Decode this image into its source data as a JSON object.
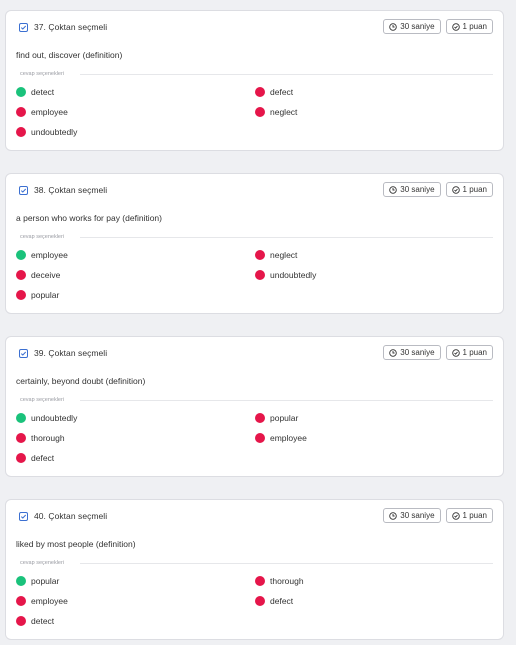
{
  "colors": {
    "correct": "#1ac27b",
    "wrong": "#e5164a"
  },
  "questions": [
    {
      "title": "37. Çoktan seçmeli",
      "time": "30 saniye",
      "points": "1 puan",
      "text": "find out, discover (definition)",
      "options_label": "cevap seçenekleri",
      "options": [
        {
          "label": "detect",
          "correct": true
        },
        {
          "label": "defect",
          "correct": false
        },
        {
          "label": "employee",
          "correct": false
        },
        {
          "label": "neglect",
          "correct": false
        },
        {
          "label": "undoubtedly",
          "correct": false
        }
      ]
    },
    {
      "title": "38. Çoktan seçmeli",
      "time": "30 saniye",
      "points": "1 puan",
      "text": "a person who works for pay (definition)",
      "options_label": "cevap seçenekleri",
      "options": [
        {
          "label": "employee",
          "correct": true
        },
        {
          "label": "neglect",
          "correct": false
        },
        {
          "label": "deceive",
          "correct": false
        },
        {
          "label": "undoubtedly",
          "correct": false
        },
        {
          "label": "popular",
          "correct": false
        }
      ]
    },
    {
      "title": "39. Çoktan seçmeli",
      "time": "30 saniye",
      "points": "1 puan",
      "text": "certainly, beyond doubt (definition)",
      "options_label": "cevap seçenekleri",
      "options": [
        {
          "label": "undoubtedly",
          "correct": true
        },
        {
          "label": "popular",
          "correct": false
        },
        {
          "label": "thorough",
          "correct": false
        },
        {
          "label": "employee",
          "correct": false
        },
        {
          "label": "defect",
          "correct": false
        }
      ]
    },
    {
      "title": "40. Çoktan seçmeli",
      "time": "30 saniye",
      "points": "1 puan",
      "text": "liked by most people (definition)",
      "options_label": "cevap seçenekleri",
      "options": [
        {
          "label": "popular",
          "correct": true
        },
        {
          "label": "thorough",
          "correct": false
        },
        {
          "label": "employee",
          "correct": false
        },
        {
          "label": "defect",
          "correct": false
        },
        {
          "label": "detect",
          "correct": false
        }
      ]
    }
  ]
}
